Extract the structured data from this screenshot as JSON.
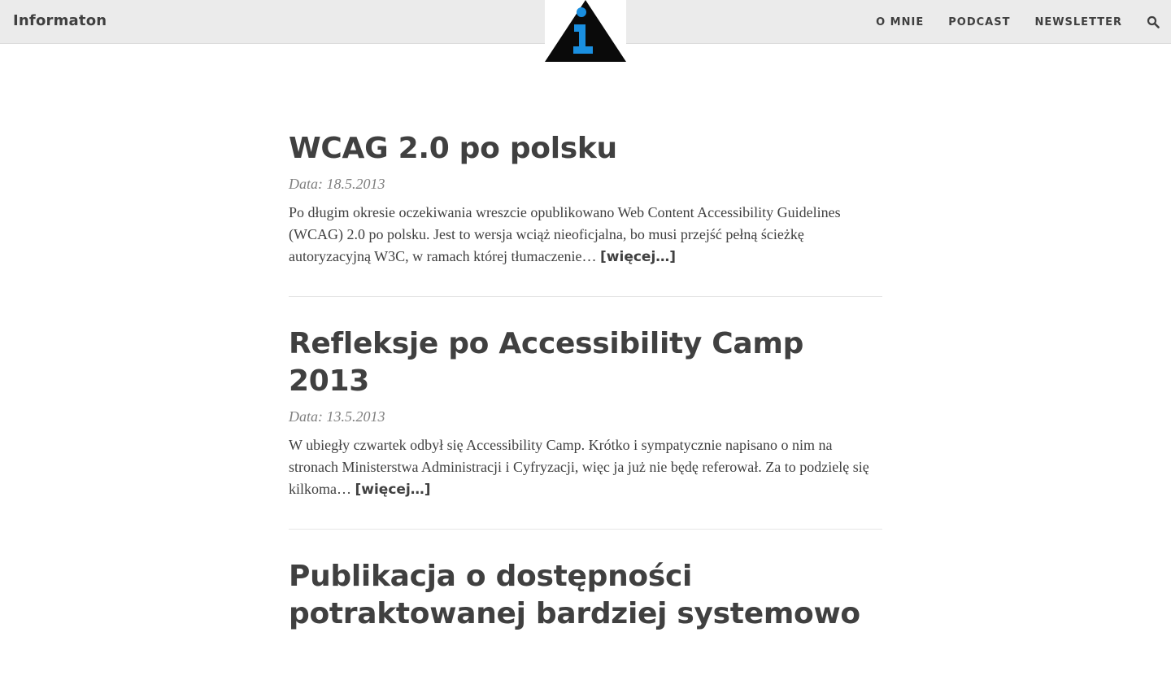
{
  "header": {
    "brand": "Informaton",
    "logo_icon": "info-triangle-icon",
    "nav": [
      {
        "label": "O MNIE"
      },
      {
        "label": "PODCAST"
      },
      {
        "label": "NEWSLETTER"
      }
    ],
    "search_icon": "search-icon"
  },
  "posts": [
    {
      "title": "WCAG 2.0 po polsku",
      "date": "Data: 18.5.2013",
      "excerpt": "Po długim okresie oczekiwania wreszcie opublikowano Web Content Accessibility Guidelines (WCAG) 2.0 po polsku. Jest to wersja wciąż nieoficjalna, bo musi przejść pełną ścieżkę autoryzacyjną W3C, w ramach której tłumaczenie… ",
      "more": "[więcej…]"
    },
    {
      "title": "Refleksje po Accessibility Camp 2013",
      "date": "Data: 13.5.2013",
      "excerpt": "W ubiegły czwartek odbył się Accessibility Camp. Krótko i sympatycznie napisano o nim na stronach Ministerstwa Administracji i Cyfryzacji, więc ja już nie będę referował. Za to podzielę się kilkoma… ",
      "more": "[więcej…]"
    },
    {
      "title": "Publikacja o dostępności potraktowanej bardziej systemowo"
    }
  ],
  "colors": {
    "header_bg": "#ebebeb",
    "text": "#404040",
    "meta": "#808080",
    "logo_blue": "#1a8fe0"
  }
}
